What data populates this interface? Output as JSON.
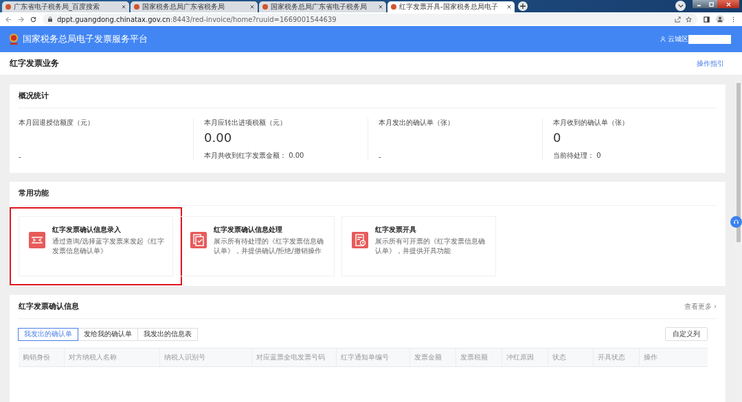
{
  "browser": {
    "tabs": [
      {
        "title": "广东省电子税务局_百度搜索",
        "selected": false
      },
      {
        "title": "国家税务总局广东省税务局",
        "selected": false
      },
      {
        "title": "国家税务总局广东省电子税务局",
        "selected": false
      },
      {
        "title": "红字发票开具-国家税务总局电子",
        "selected": true
      }
    ],
    "url_host": "dppt.guangdong.chinatax.gov.cn",
    "url_rest": ":8443/red-invoice/home?ruuid=1669001544639"
  },
  "header": {
    "title": "国家税务总局电子发票服务平台",
    "user": "云城区"
  },
  "page": {
    "title": "红字发票业务",
    "guide_link": "操作指引"
  },
  "overview": {
    "title": "概况统计",
    "stats": [
      {
        "label": "本月回退授信额度（元）",
        "footer": "-"
      },
      {
        "label": "本月应转出进项税额（元）",
        "value": "0.00",
        "footer": "本月共收到红字发票金额： 0.00"
      },
      {
        "label": "本月发出的确认单（张）",
        "footer": "-"
      },
      {
        "label": "本月收到的确认单（张）",
        "value": "0",
        "footer": "当前待处理： 0"
      }
    ]
  },
  "functions": {
    "title": "常用功能",
    "items": [
      {
        "kind": "entry",
        "title": "红字发票确认信息录入",
        "desc": "通过查询/选择蓝字发票来发起《红字发票信息确认单》",
        "highlighted": true
      },
      {
        "kind": "process",
        "title": "红字发票确认信息处理",
        "desc": "展示所有待处理的《红字发票信息确认单》，并提供确认/拒绝/撤销操作",
        "highlighted": false
      },
      {
        "kind": "issue",
        "title": "红字发票开具",
        "desc": "展示所有可开票的《红字发票信息确认单》，并提供开具功能",
        "highlighted": false
      }
    ]
  },
  "confirmations": {
    "title": "红字发票确认信息",
    "more_link": "查看更多 ›",
    "tabs": [
      {
        "label": "我发出的确认单",
        "selected": true
      },
      {
        "label": "发给我的确认单",
        "selected": false
      },
      {
        "label": "我发出的信息表",
        "selected": false
      }
    ],
    "customize_button": "自定义列",
    "columns": [
      "购销身份",
      "对方纳税人名称",
      "纳税人识别号",
      "对应蓝票全电发票号码",
      "红字通知单编号",
      "发票金额",
      "发票税额",
      "冲红原因",
      "状态",
      "开具状态",
      "操作"
    ]
  }
}
